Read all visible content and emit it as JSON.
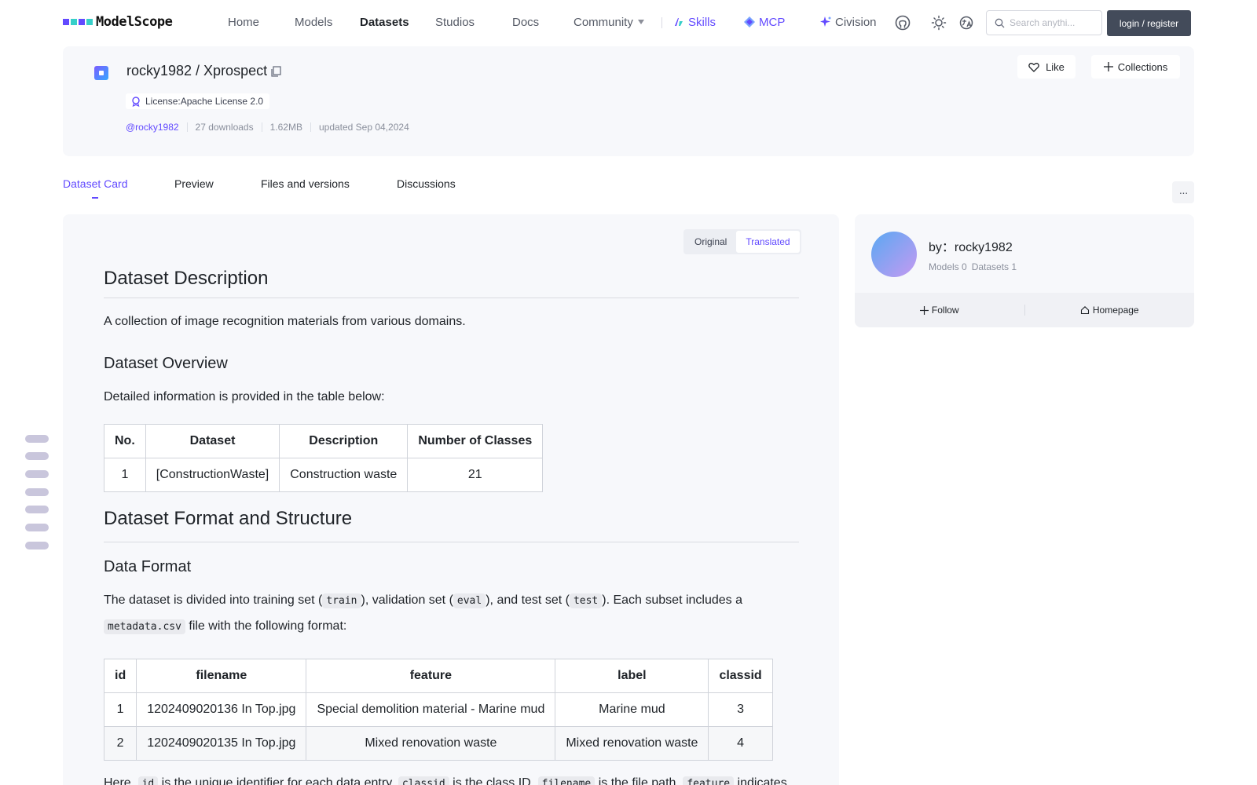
{
  "brand": {
    "name": "ModelScope",
    "accent": "#624aff"
  },
  "nav": {
    "home": "Home",
    "models": "Models",
    "datasets": "Datasets",
    "studios": "Studios",
    "docs": "Docs",
    "community": "Community",
    "skills": "Skills",
    "mcp": "MCP",
    "civision": "Civision",
    "search_placeholder": "Search anythi...",
    "login": "login / register"
  },
  "dataset": {
    "title": "rocky1982 / Xprospect",
    "license": "License:Apache License 2.0",
    "owner": "@rocky1982",
    "downloads": "27 downloads",
    "size": "1.62MB",
    "updated": "updated Sep 04,2024",
    "like": "Like",
    "collections": "Collections"
  },
  "tabs": [
    "Dataset Card",
    "Preview",
    "Files and versions",
    "Discussions"
  ],
  "view_toggle": {
    "original": "Original",
    "translated": "Translated"
  },
  "content": {
    "h_description": "Dataset Description",
    "p_description": "A collection of image recognition materials from various domains.",
    "h_overview": "Dataset Overview",
    "p_overview": "Detailed information is provided in the table below:",
    "overview_table": {
      "headers": [
        "No.",
        "Dataset",
        "Description",
        "Number of Classes"
      ],
      "rows": [
        [
          "1",
          "[ConstructionWaste]",
          "Construction waste",
          "21"
        ]
      ]
    },
    "h_format_structure": "Dataset Format and Structure",
    "h_data_format": "Data Format",
    "format_text": {
      "t1": "The dataset is divided into training set (",
      "c_train": "train",
      "t2": "), validation set (",
      "c_eval": "eval",
      "t3": "), and test set (",
      "c_test": "test",
      "t4": "). Each subset includes a",
      "c_metadata": "metadata.csv",
      "t5": " file with the following format:"
    },
    "format_table": {
      "headers": [
        "id",
        "filename",
        "feature",
        "label",
        "classid"
      ],
      "rows": [
        [
          "1",
          "1202409020136 In Top.jpg",
          "Special demolition material - Marine mud",
          "Marine mud",
          "3"
        ],
        [
          "2",
          "1202409020135 In Top.jpg",
          "Mixed renovation waste",
          "Mixed renovation waste",
          "4"
        ]
      ]
    },
    "footer_text": {
      "t1": "Here, ",
      "c_id": "id",
      "t2": " is the unique identifier for each data entry, ",
      "c_classid": "classid",
      "t3": " is the class ID, ",
      "c_filename": "filename",
      "t4": " is the file path, ",
      "c_feature": "feature",
      "t5": " indicates"
    }
  },
  "author": {
    "by": "by：rocky1982",
    "models": "Models 0",
    "datasets": "Datasets 1",
    "follow": "Follow",
    "homepage": "Homepage"
  }
}
